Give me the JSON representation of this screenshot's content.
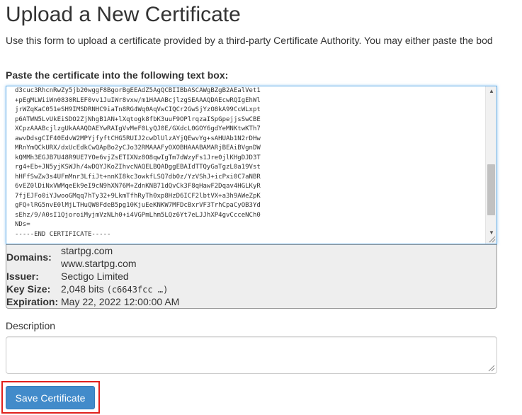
{
  "page": {
    "title": "Upload a New Certificate",
    "intro": "Use this form to upload a certificate provided by a third-party Certificate Authority. You may either paste the bod"
  },
  "certificate_field": {
    "label": "Paste the certificate into the following text box:",
    "text": "d3cuc3RhcnRwZy5jb20wggF8BgorBgEEAdZ5AgQCBIIBbASCAWgBZgB2AEalVet1\n+pEgMLWiiWn0830RLEF0vv1JuIWr8vxw/m1HAAABcjlzgSEAAAQDAEcwRQIgEhWl\njrWZqKaC051eSH9IMSDRNHC9iaTn8RG4Wq0AqVwCIQCr2GwSjYzO8kA99CcWLxpt\np6ATWN5LvUkEiSDO2ZjNhgB1AN+lXqtogk8fbK3uuF9OPlrqzaISpGpejjsSwCBE\nXCpzAAABcjlzgUkAAAQDAEYwRAIgVvMeF0LyQJ0E/GXdcL0GOY6gdYeMNKtwKTh7\nawvDdsgCIF40EdvW2MPYjfyftCHG5RUIJ2cwDlUlzAYjQEwvYg+sAHUAb1N2rDHw\nMRnYmQCkURX/dxUcEdkCwQApBo2yCJo32RMAAAFyOXOBHAAABAMARjBEAiBVgnDW\nkQMMh3EGJB7U48R9UE7YOe6vjZsETIXNz8O8qwIgTm7dWzyFs1Jre0jlKHgDJD3T\nrg4+Eb+JN5yjKSWJh/4wDQYJKoZIhvcNAQELBQADggEBAIdTTQyGaTgzL0a19Vst\nhHFfSwZw3s4UFmMnr3LfiJt+nnKI8kc3owkfLSQ7db0z/YzVShJ+icPxi0C7aNBR\n6vEZ0lDiNxVWMqeEk9eI9cN9hXN76M+ZdnKNB71dQvCk3F8qHawF2Dqav4HGLKyR\n7fjEJFo0iYJwooGMqq7hTy32+9LkmTfhRyTh0xp8HzD6ICF2lbtVX+a3h9AWeZpK\ngFQ+lRG5nvE0lMjLTHuQW8FdeB5pg10KjuEeKNKW7MFDcBxrVF3TrhCpaCyOB3Yd\nsEhz/9/A0sI1QjoroiMyjmVzNLh0+i4VGPmLhm5LQz6Yt7eLJJhXP4gvCcceNCh0\nNDs=\n-----END CERTIFICATE-----"
  },
  "certificate_details": {
    "domains_label": "Domains:",
    "domains": [
      "startpg.com",
      "www.startpg.com"
    ],
    "issuer_label": "Issuer:",
    "issuer": "Sectigo Limited",
    "key_size_label": "Key Size:",
    "key_size": "2,048 bits",
    "key_id": "(c6643fcc …)",
    "expiration_label": "Expiration:",
    "expiration": "May 22, 2022 12:00:00 AM"
  },
  "description_field": {
    "label": "Description",
    "value": ""
  },
  "actions": {
    "save_label": "Save Certificate"
  },
  "colors": {
    "primary_button": "#428bca",
    "focus_border": "#66afe9",
    "highlight_outline": "#e0201c",
    "grammarly": "#15c39a"
  },
  "icons": {
    "scroll_up": "triangle-up",
    "scroll_down": "triangle-down",
    "grammarly": "grammarly-g",
    "resize": "diagonal-grip"
  }
}
